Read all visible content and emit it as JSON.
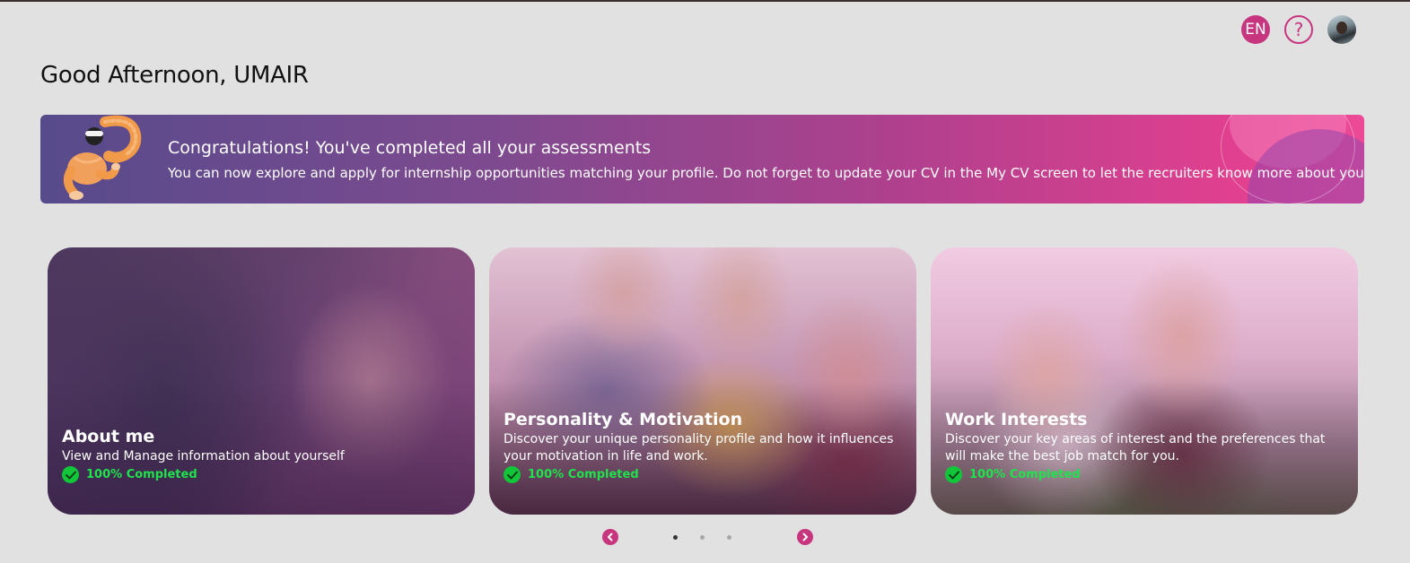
{
  "header": {
    "language": "EN",
    "help_label": "?",
    "greeting": "Good Afternoon, UMAIR"
  },
  "banner": {
    "title": "Congratulations! You've completed all your assessments",
    "text": "You can now explore and apply for internship opportunities matching your profile. Do not forget to update your CV in the My CV screen to let the recruiters know more about you."
  },
  "cards": [
    {
      "title": "About me",
      "description": "View and Manage information about yourself",
      "status": "100% Completed",
      "progress_percent": 100
    },
    {
      "title": "Personality & Motivation",
      "description": "Discover your unique personality profile and how it influences your motivation in life and work.",
      "status": "100% Completed",
      "progress_percent": 100
    },
    {
      "title": "Work Interests",
      "description": "Discover your key areas of interest and the preferences that will make the best job match for you.",
      "status": "100% Completed",
      "progress_percent": 100
    }
  ],
  "pagination": {
    "page_count": 3,
    "active_page": 1
  },
  "colors": {
    "accent": "#c8357f",
    "background": "#e1e1e1",
    "completed": "#1fe34c"
  },
  "icons": {
    "language": "language-badge-icon",
    "help": "question-circle-icon",
    "completed": "check-circle-icon",
    "prev": "chevron-left-icon",
    "next": "chevron-right-icon"
  }
}
